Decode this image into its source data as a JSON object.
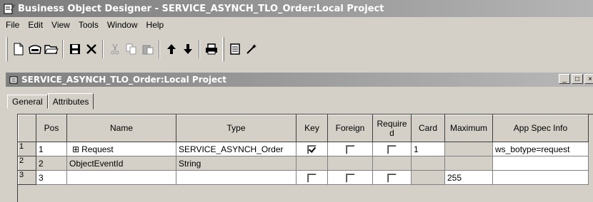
{
  "window": {
    "title": "Business Object Designer - SERVICE_ASYNCH_TLO_Order:Local Project"
  },
  "menu": [
    "File",
    "Edit",
    "View",
    "Tools",
    "Window",
    "Help"
  ],
  "toolbar": {
    "buttons": [
      "new-icon",
      "open-icon",
      "open-folder-icon",
      "save-icon",
      "delete-icon",
      "cut-icon",
      "copy-icon",
      "paste-icon",
      "move-up-icon",
      "move-down-icon",
      "print-icon",
      "properties-icon",
      "wand-icon"
    ]
  },
  "document": {
    "title": "SERVICE_ASYNCH_TLO_Order:Local Project",
    "window_buttons": {
      "minimize": "_",
      "maximize": "□",
      "close": "×"
    },
    "tabs": [
      "General",
      "Attributes"
    ],
    "active_tab": "Attributes"
  },
  "grid": {
    "columns": [
      "Pos",
      "Name",
      "Type",
      "Key",
      "Foreign",
      "Required",
      "Card",
      "Maximum",
      "App Spec Info"
    ],
    "rows": [
      {
        "row": "1",
        "pos": "1",
        "name": "Request",
        "expand": "⊞",
        "type": "SERVICE_ASYNCH_Order",
        "key": true,
        "foreign": false,
        "required": false,
        "card": "1",
        "maximum": "",
        "app_spec_info": "ws_botype=request"
      },
      {
        "row": "2",
        "pos": "2",
        "name": "ObjectEventId",
        "type": "String",
        "card": "",
        "maximum": "",
        "app_spec_info": ""
      },
      {
        "row": "3",
        "pos": "3",
        "name": "",
        "type": "",
        "key": false,
        "foreign": false,
        "required": false,
        "card": "",
        "maximum": "255",
        "app_spec_info": ""
      }
    ]
  }
}
